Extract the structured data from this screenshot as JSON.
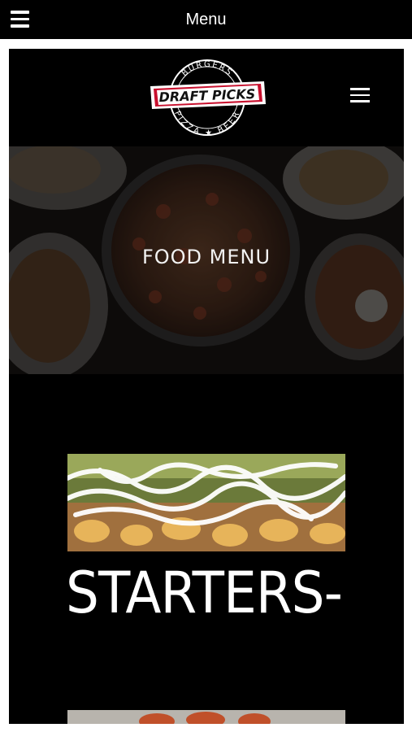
{
  "app_bar": {
    "title": "Menu",
    "menu_icon": "hamburger-icon"
  },
  "site": {
    "logo": {
      "top": "BURGERS",
      "name": "DRAFT PICKS",
      "bottom": "PIZZA ★ BEER"
    },
    "nav_icon": "hamburger-icon"
  },
  "hero": {
    "title": "FOOD MENU"
  },
  "sections": [
    {
      "title": "STARTERS-"
    }
  ],
  "colors": {
    "background": "#000000",
    "text": "#ffffff",
    "accent": "#c8102e"
  }
}
